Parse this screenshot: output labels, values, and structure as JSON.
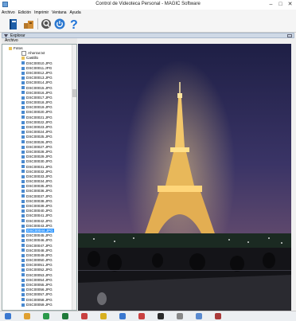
{
  "window": {
    "title": "Control de Videoteca Personal - MAGIC Software",
    "min": "–",
    "max": "□",
    "close": "✕"
  },
  "menu": [
    "Archivo",
    "Edición",
    "Imprimir",
    "Ventana",
    "Ayuda"
  ],
  "toolbar": {
    "icons": [
      "book-icon",
      "boxes-icon",
      "search-icon",
      "power-icon",
      "help-icon"
    ]
  },
  "panel": {
    "title": "Explorar",
    "tab": "Archivo"
  },
  "tree": {
    "root": "Fotos",
    "items": [
      "Ahorrar.txt",
      "Castillo",
      "DSC00010.JPG",
      "DSC00011.JPG",
      "DSC00012.JPG",
      "DSC00013.JPG",
      "DSC00014.JPG",
      "DSC00015.JPG",
      "DSC00016.JPG",
      "DSC00017.JPG",
      "DSC00018.JPG",
      "DSC00019.JPG",
      "DSC00020.JPG",
      "DSC00021.JPG",
      "DSC00022.JPG",
      "DSC00023.JPG",
      "DSC00024.JPG",
      "DSC00025.JPG",
      "DSC00026.JPG",
      "DSC00027.JPG",
      "DSC00028.JPG",
      "DSC00029.JPG",
      "DSC00030.JPG",
      "DSC00031.JPG",
      "DSC00032.JPG",
      "DSC00033.JPG",
      "DSC00034.JPG",
      "DSC00035.JPG",
      "DSC00036.JPG",
      "DSC00037.JPG",
      "DSC00038.JPG",
      "DSC00039.JPG",
      "DSC00040.JPG",
      "DSC00041.JPG",
      "DSC00042.JPG",
      "DSC00043.JPG",
      "DSC00044.JPG",
      "DSC00045.JPG",
      "DSC00046.JPG",
      "DSC00047.JPG",
      "DSC00048.JPG",
      "DSC00049.JPG",
      "DSC00050.JPG",
      "DSC00051.JPG",
      "DSC00052.JPG",
      "DSC00053.JPG",
      "DSC00054.JPG",
      "DSC00055.JPG",
      "DSC00056.JPG",
      "DSC00057.JPG",
      "DSC00058.JPG",
      "DSC00059.JPG"
    ],
    "selected_index": 36
  },
  "viewer": {
    "image": "eiffel-tower-night-photo"
  },
  "taskbar": {
    "icons": [
      "start-icon",
      "folder-icon",
      "browser-icon",
      "excel-icon",
      "app-icon",
      "chrome-icon",
      "app2-icon",
      "app3-icon",
      "app4-icon",
      "app5-icon",
      "app6-icon",
      "app7-icon"
    ]
  }
}
